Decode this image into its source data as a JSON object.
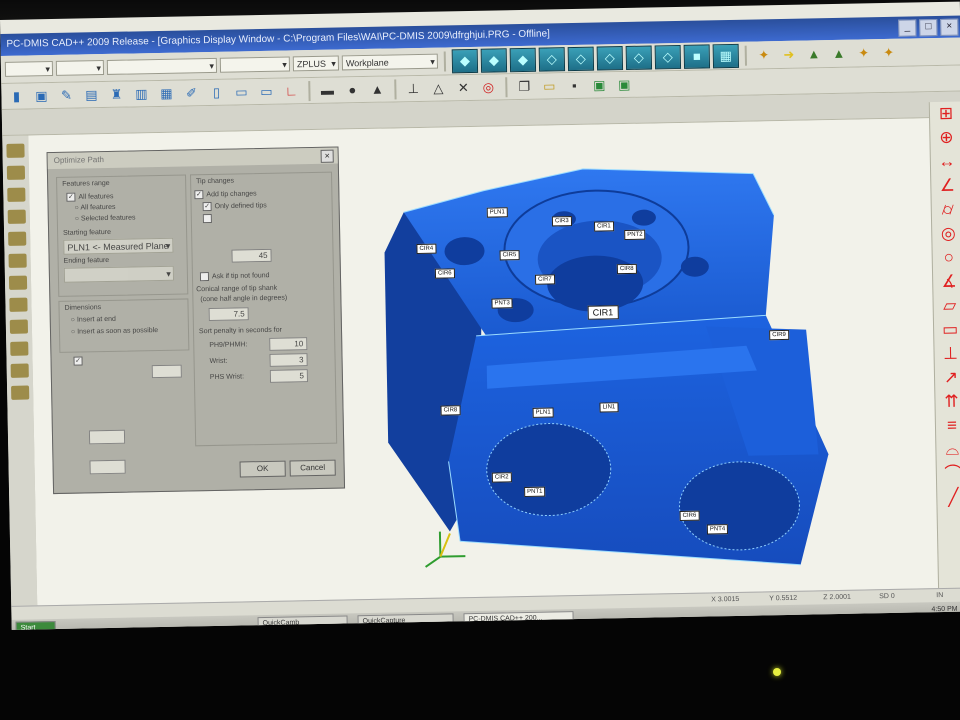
{
  "window": {
    "title": "PC-DMIS CAD++ 2009 Release - [Graphics Display Window - C:\\Program Files\\WAI\\PC-DMIS 2009\\dfrghjui.PRG - Offline]",
    "controls": [
      "_",
      "□",
      "×"
    ]
  },
  "toolbar": {
    "probe_axis": "ZPLUS",
    "workplane": "Workplane"
  },
  "dialog": {
    "title": "Optimize Path",
    "left_group_title": "Features range",
    "all_features": "All features",
    "all_features_opt": "All features",
    "selected_features": "Selected features",
    "starting_feature_label": "Starting feature",
    "starting_feature_value": "PLN1 <- Measured Plane",
    "ending_feature_label": "Ending feature",
    "ending_feature_value": "",
    "dimensions_title": "Dimensions",
    "insert_at_end": "Insert at end",
    "insert_asap": "Insert as soon as possible",
    "tip_changes_title": "Tip changes",
    "add_tip_changes": "Add tip changes",
    "only_defined_tips": "Only defined tips",
    "cone_half_angle_value": "45",
    "ask_if_tip_not_found": "Ask if tip not found",
    "conical_range_label": "Conical range of tip shank",
    "cone_half_angle_label": "(cone half angle in degrees)",
    "conical_range_value": "7.5",
    "sort_penalty_label": "Sort penalty in seconds for",
    "penalties": [
      {
        "label": "PH9/PHMH:",
        "value": "10"
      },
      {
        "label": "Wrist:",
        "value": "3"
      },
      {
        "label": "PHS Wrist:",
        "value": "5"
      }
    ],
    "ok": "OK",
    "cancel": "Cancel"
  },
  "features": [
    {
      "label": "PLN1"
    },
    {
      "label": "CIR3"
    },
    {
      "label": "CIR1"
    },
    {
      "label": "CIR4"
    },
    {
      "label": "CIR5"
    },
    {
      "label": "PNT2"
    },
    {
      "label": "CIR6"
    },
    {
      "label": "CIR7"
    },
    {
      "label": "CIR8"
    },
    {
      "label": "PNT3"
    },
    {
      "label": "CIR1",
      "highlight": true
    },
    {
      "label": "CIR9"
    },
    {
      "label": "CIR8"
    },
    {
      "label": "PLN1"
    },
    {
      "label": "LIN1"
    },
    {
      "label": "CIR2"
    },
    {
      "label": "PNT1"
    },
    {
      "label": "CIR6"
    },
    {
      "label": "PNT4"
    }
  ],
  "status": {
    "x": "X 3.0015",
    "y": "Y 0.5512",
    "z": "Z 2.0001",
    "sd": "SD 0",
    "mode": "IN"
  },
  "taskbar": {
    "start": "Start",
    "tasks": [
      "QuickCamb",
      "QuickCapture",
      "PC-DMIS CAD++ 200..."
    ],
    "clock": "4:50 PM"
  },
  "colors": {
    "part": "#1b5fd6",
    "part_shadow": "#0e3c9a",
    "titlebar": "#2a4f9c",
    "right_icons": "#e02020"
  }
}
